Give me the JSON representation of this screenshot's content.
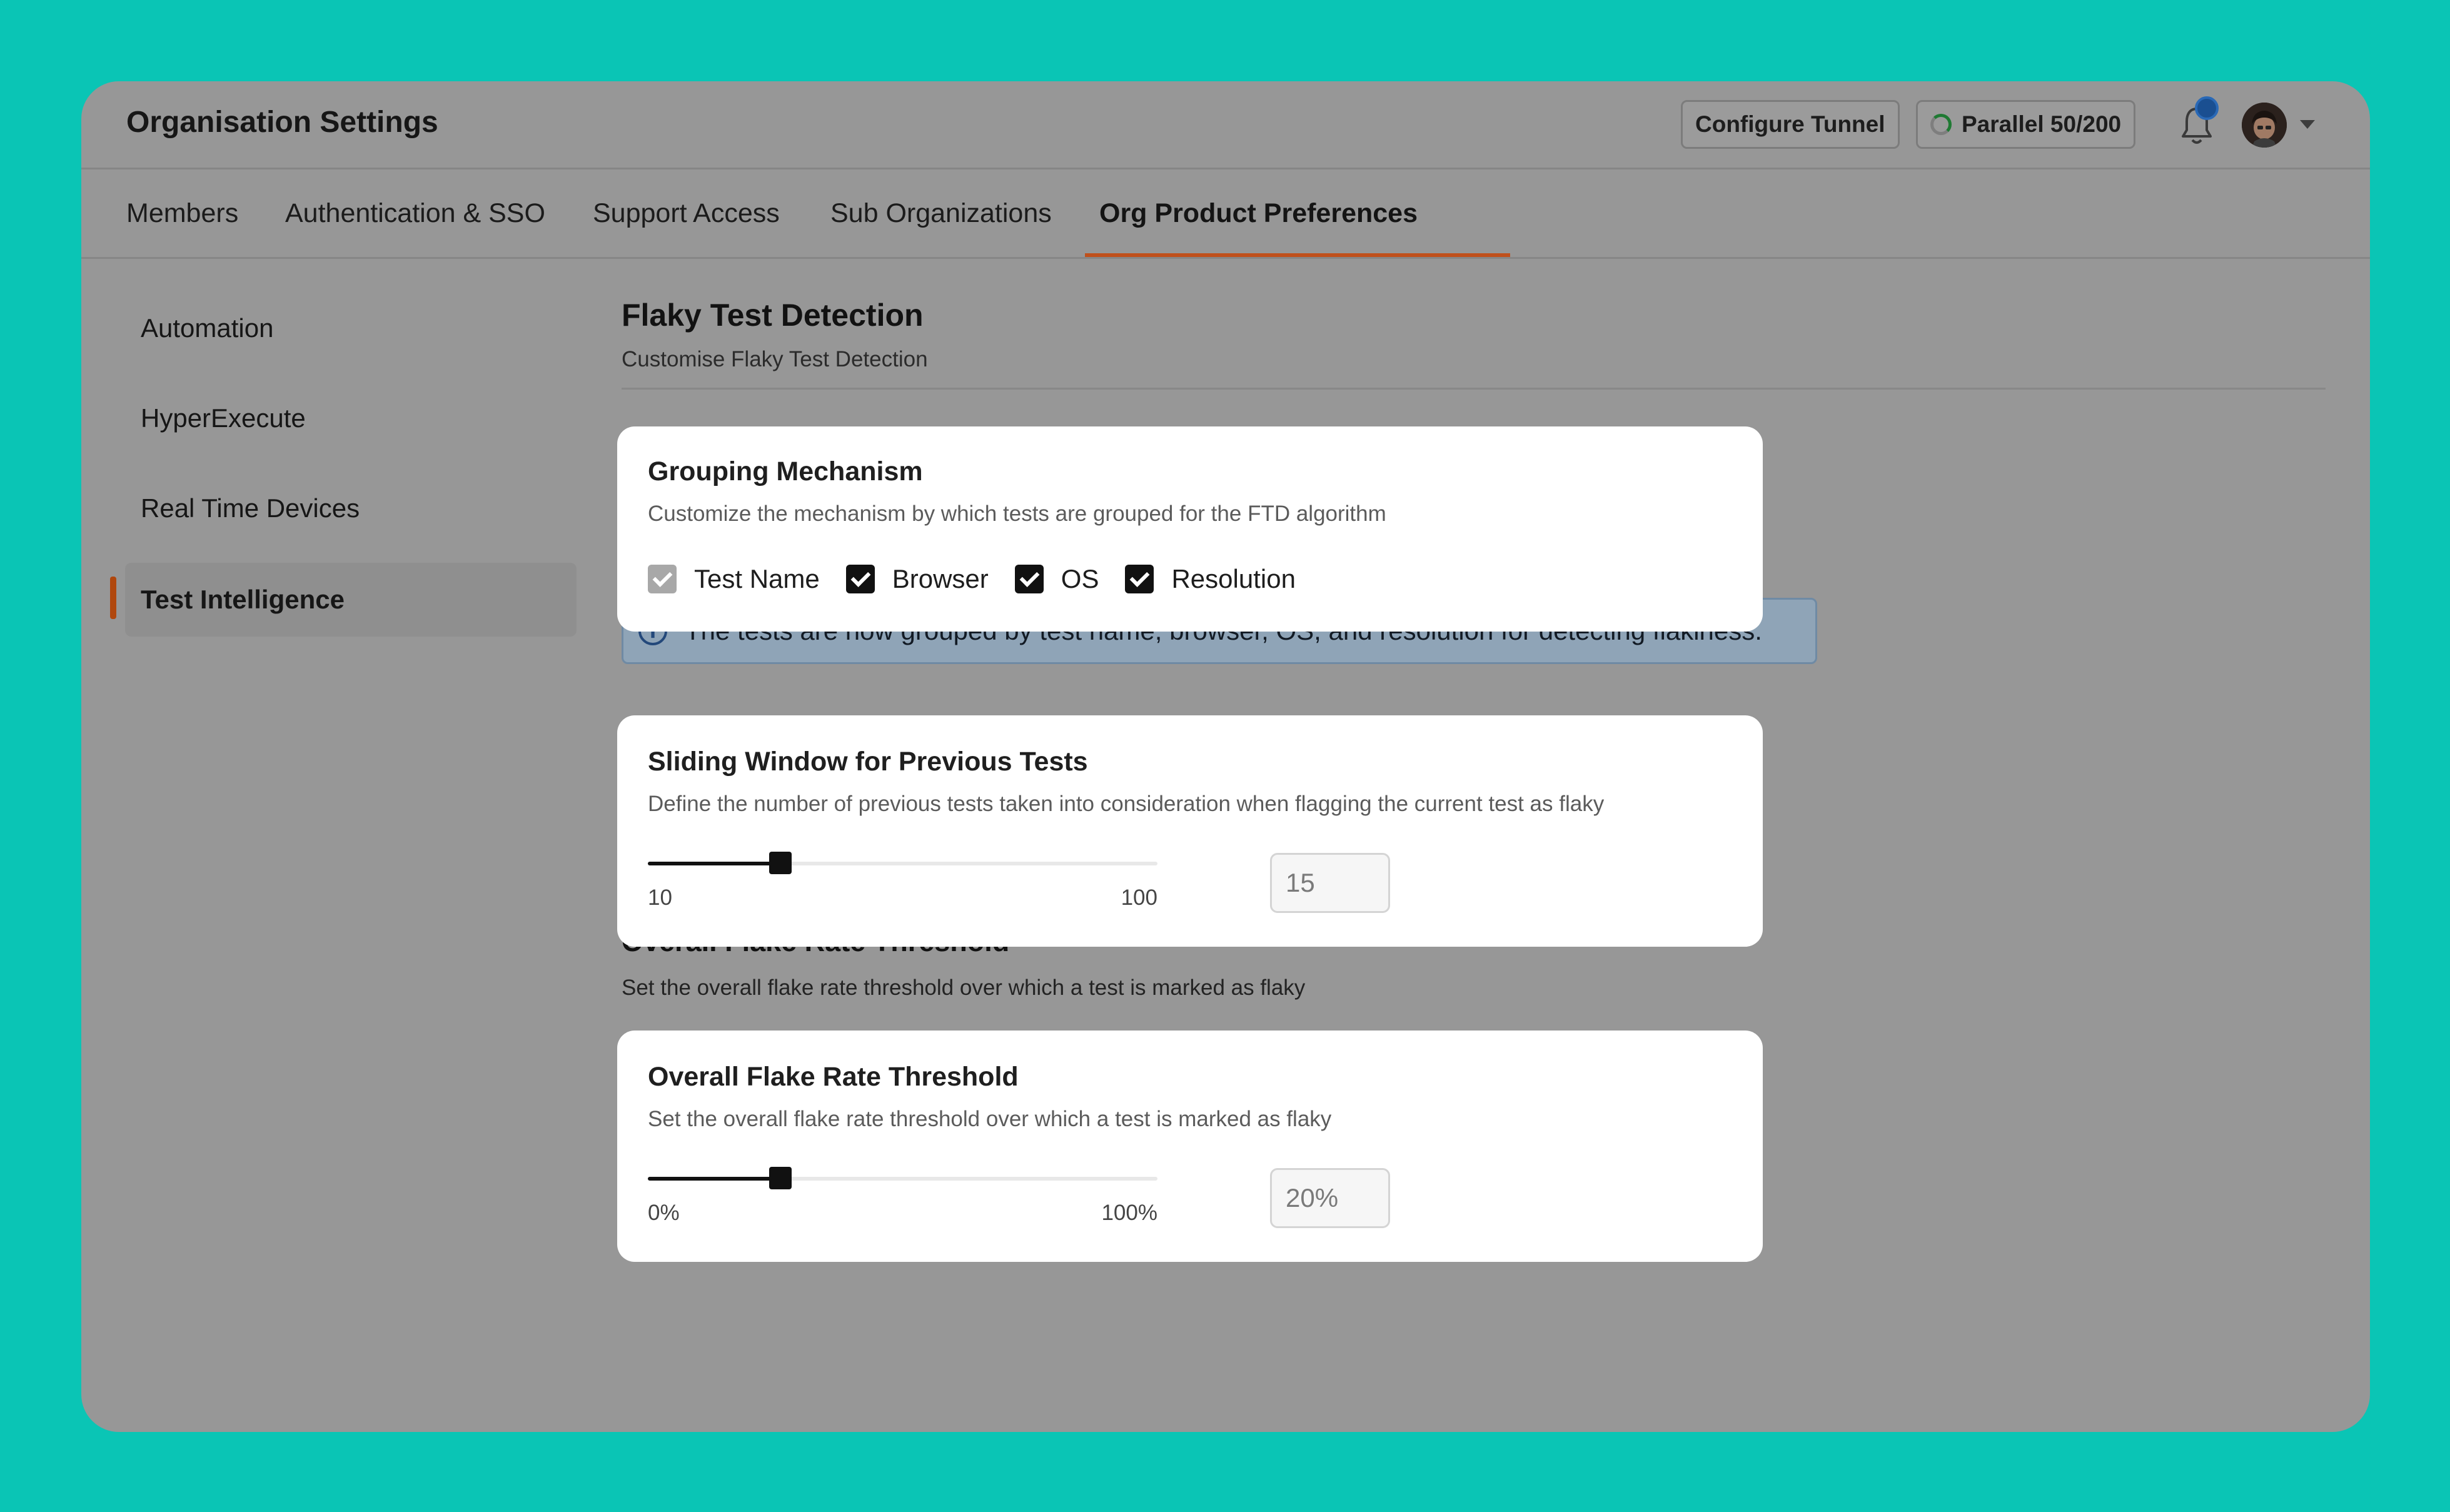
{
  "header": {
    "title": "Organisation Settings",
    "configure_tunnel": "Configure Tunnel",
    "parallel": "Parallel 50/200"
  },
  "tabs": [
    {
      "label": "Members"
    },
    {
      "label": "Authentication & SSO"
    },
    {
      "label": "Support Access"
    },
    {
      "label": "Sub Organizations"
    },
    {
      "label": "Org Product Preferences",
      "active": true
    }
  ],
  "sidebar": {
    "items": [
      {
        "label": "Automation"
      },
      {
        "label": "HyperExecute"
      },
      {
        "label": "Real Time Devices"
      },
      {
        "label": "Test Intelligence",
        "active": true
      }
    ]
  },
  "section": {
    "title": "Flaky Test Detection",
    "subtitle": "Customise Flaky Test Detection"
  },
  "background": {
    "info_banner": "The tests are now grouped by test name, browser, OS, and resolution for detecting flakiness.",
    "flake_title": "Overall Flake Rate Threshold",
    "flake_sub": "Set the overall flake rate threshold over which a test is marked as flaky"
  },
  "grouping": {
    "title": "Grouping Mechanism",
    "subtitle": "Customize the mechanism by which tests are grouped for the FTD algorithm",
    "options": [
      {
        "label": "Test Name",
        "checked": true,
        "disabled": true
      },
      {
        "label": "Browser",
        "checked": true
      },
      {
        "label": "OS",
        "checked": true
      },
      {
        "label": "Resolution",
        "checked": true
      }
    ]
  },
  "sliding_window": {
    "title": "Sliding Window for Previous Tests",
    "subtitle": "Define the number of previous tests taken into consideration when flagging the current test as flaky",
    "min_label": "10",
    "max_label": "100",
    "value": "15",
    "level_fraction": 0.26
  },
  "flake_threshold": {
    "title": "Overall Flake Rate Threshold",
    "subtitle": "Set the overall flake rate threshold over which a test is marked as flaky",
    "min_label": "0%",
    "max_label": "100%",
    "value": "20%",
    "level_fraction": 0.26
  },
  "colors": {
    "accent_tab": "#c0501c",
    "backdrop": "#0ac5b5",
    "checkbox": "#111111"
  }
}
